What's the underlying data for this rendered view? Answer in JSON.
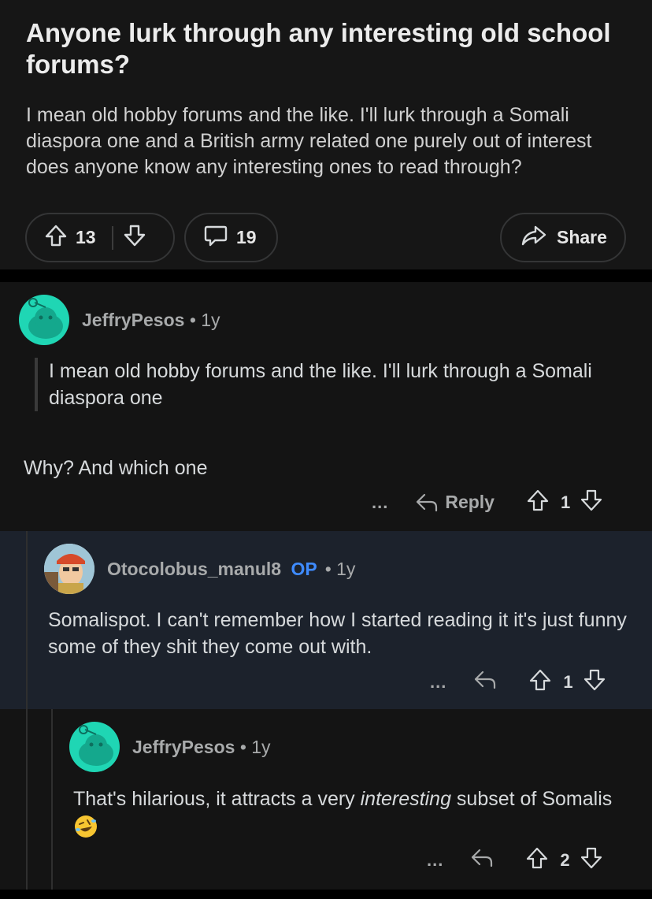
{
  "post": {
    "title": "Anyone lurk through any interesting old school forums?",
    "body": "I mean old hobby forums and the like. I'll lurk through a Somali diaspora one and a British army related one purely out of interest does anyone know any interesting ones to read through?",
    "upvotes": "13",
    "comments": "19",
    "share_label": "Share"
  },
  "comments": [
    {
      "username": "JeffryPesos",
      "age": "• 1y",
      "quote": "I mean old hobby forums and the like. I'll lurk through a Somali diaspora one",
      "text": "Why? And which one",
      "more": "...",
      "reply_label": "Reply",
      "score": "1"
    },
    {
      "username": "Otocolobus_manul8",
      "op_badge": "OP",
      "age": "• 1y",
      "text": "Somalispot. I can't remember how I started reading it it's just funny some of they shit they come out with.",
      "more": "...",
      "score": "1"
    },
    {
      "username": "JeffryPesos",
      "age": "• 1y",
      "text_before": "That's hilarious, it attracts a very ",
      "text_italic": "interesting",
      "text_after": " subset of Somalis",
      "emoji": "rolling-on-floor-laughing",
      "more": "...",
      "score": "2"
    }
  ],
  "colors": {
    "background": "#0b0b0b",
    "card": "#161616",
    "highlight_comment": "#1c222c",
    "op_badge": "#3e8bff",
    "avatar_teal": "#1fd6b4"
  }
}
